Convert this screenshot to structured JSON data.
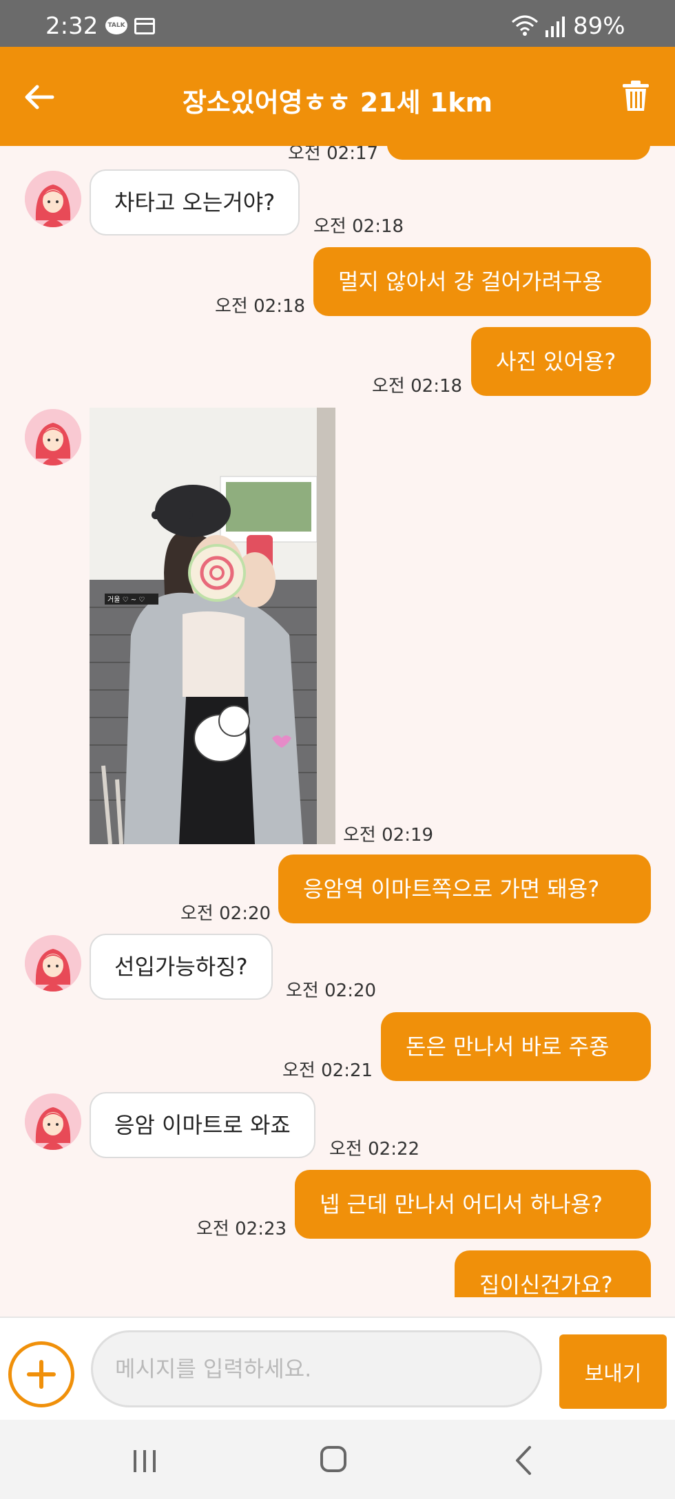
{
  "status_bar": {
    "time": "2:32",
    "kakao_badge": "TALK",
    "battery": "89%"
  },
  "header": {
    "title": "장소있어영ㅎㅎ 21세 1km",
    "back_icon": "arrow-left-icon",
    "delete_icon": "trash-icon"
  },
  "messages": [
    {
      "side": "out",
      "text": "",
      "time": "오전 02:17"
    },
    {
      "side": "in",
      "text": "차타고 오는거야?",
      "time": "오전 02:18"
    },
    {
      "side": "out",
      "text": "멀지 않아서 걍 걸어가려구용",
      "time": "오전 02:18"
    },
    {
      "side": "out",
      "text": "사진 있어용?",
      "time": "오전 02:18"
    },
    {
      "side": "in",
      "type": "image",
      "time": "오전 02:19",
      "photo_caption": "거울 ♡ ~ ♡"
    },
    {
      "side": "out",
      "text": "응암역 이마트쪽으로 가면 돼용?",
      "time": "오전 02:20"
    },
    {
      "side": "in",
      "text": "선입가능하징?",
      "time": "오전 02:20"
    },
    {
      "side": "out",
      "text": "돈은 만나서 바로 주죵",
      "time": "오전 02:21"
    },
    {
      "side": "in",
      "text": "응암 이마트로 와죠",
      "time": "오전 02:22"
    },
    {
      "side": "out",
      "text": "넵 근데 만나서 어디서 하나용?",
      "time": "오전 02:23"
    },
    {
      "side": "out",
      "text": "집이신건가요?",
      "time": ""
    }
  ],
  "composer": {
    "placeholder": "메시지를 입력하세요.",
    "send_label": "보내기",
    "attach_icon": "plus-circle-icon"
  },
  "nav_bar": {
    "recent_icon": "recent-apps-icon",
    "home_icon": "home-icon",
    "back_icon": "back-chevron-icon"
  },
  "colors": {
    "accent": "#f0900a",
    "background": "#fdf4f2",
    "status_bar": "#6b6b6b"
  }
}
